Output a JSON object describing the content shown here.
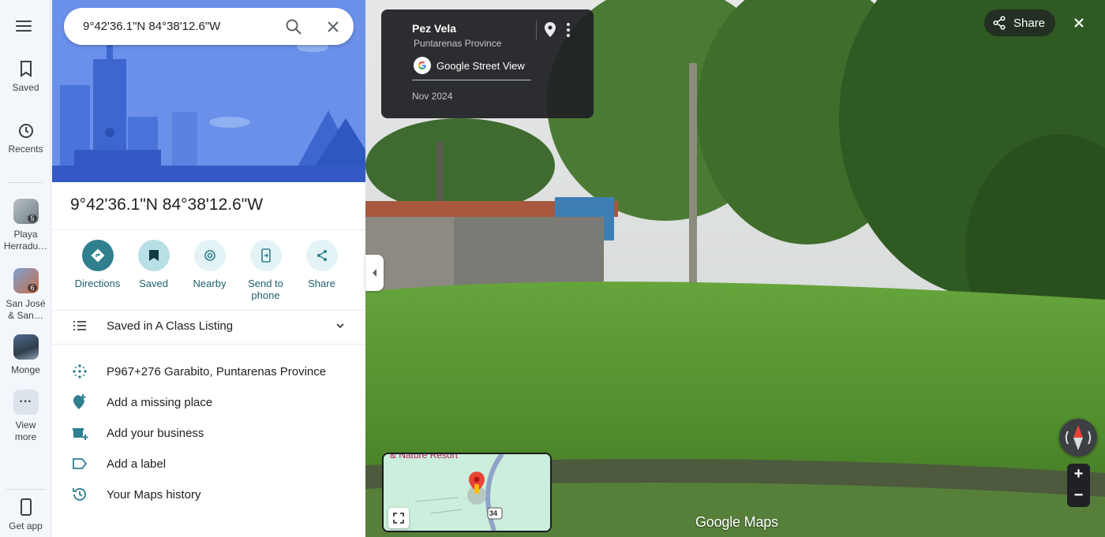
{
  "rail": {
    "saved_label": "Saved",
    "recents_label": "Recents",
    "recent_items": [
      {
        "label": "Playa\nHerradu…",
        "badge": "5"
      },
      {
        "label": "San José\n& San…",
        "badge": "6"
      },
      {
        "label": "Monge",
        "badge": ""
      }
    ],
    "view_more_label": "View\nmore",
    "get_app_label": "Get app"
  },
  "search": {
    "value": "9°42'36.1\"N 84°38'12.6\"W"
  },
  "place": {
    "title": "9°42'36.1\"N 84°38'12.6\"W"
  },
  "actions": [
    {
      "label": "Directions"
    },
    {
      "label": "Saved"
    },
    {
      "label": "Nearby"
    },
    {
      "label": "Send to\nphone"
    },
    {
      "label": "Share"
    }
  ],
  "saved_list": {
    "label": "Saved in A Class Listing"
  },
  "details": {
    "plus_code": "P967+276 Garabito, Puntarenas Province",
    "add_missing_place": "Add a missing place",
    "add_business": "Add your business",
    "add_label": "Add a label",
    "maps_history": "Your Maps history"
  },
  "street_view": {
    "place_name": "Pez Vela",
    "province": "Puntarenas Province",
    "source": "Google Street View",
    "date": "Nov 2024",
    "share_label": "Share",
    "wordmark": "Google Maps",
    "minimap_label": "& Nature Resort",
    "route_shield": "34"
  },
  "colors": {
    "accent": "#2f7f8f",
    "hero": "#5c86e6",
    "pin": "#ea4335"
  }
}
